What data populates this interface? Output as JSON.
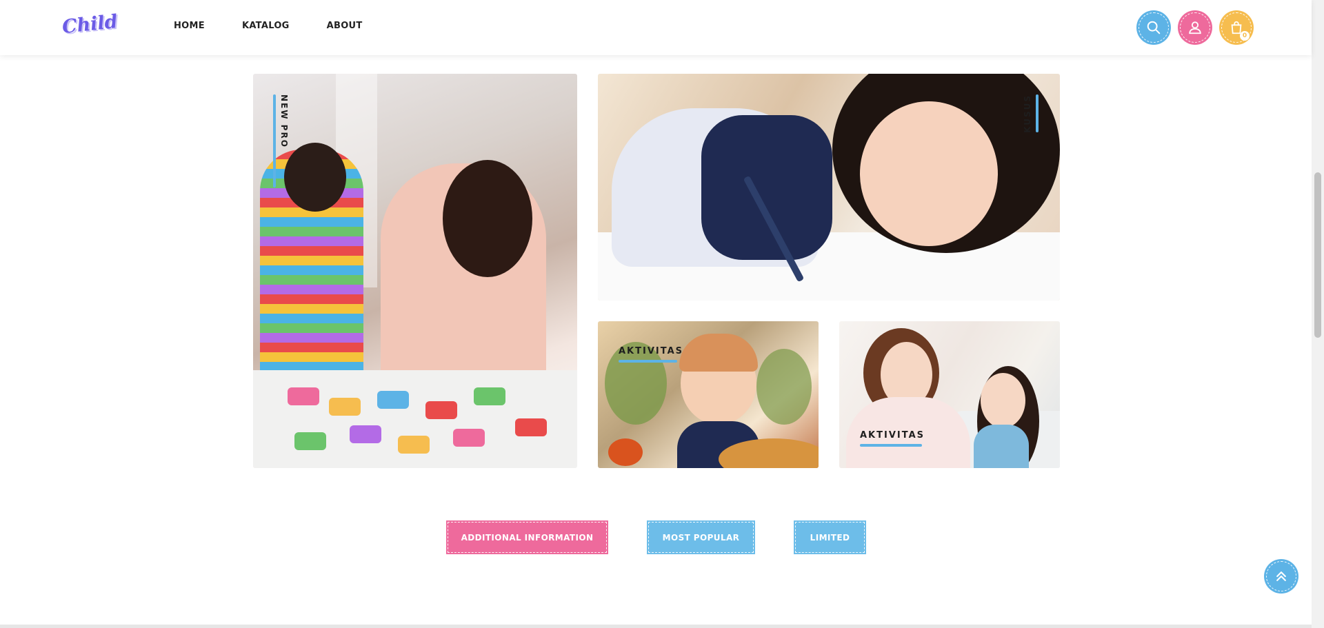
{
  "header": {
    "logo_text": "Child",
    "nav": [
      {
        "label": "HOME"
      },
      {
        "label": "KATALOG"
      },
      {
        "label": "ABOUT"
      }
    ],
    "icons": {
      "search": "search-icon",
      "account": "user-icon",
      "cart": "shopping-bag-icon",
      "cart_count": "0"
    }
  },
  "banners": [
    {
      "label": "NEW PRODUCT",
      "visible_label": "NEW PRO"
    },
    {
      "label": "KUSUS"
    },
    {
      "label": "AKTIVITAS"
    },
    {
      "label": "AKTIVITAS"
    }
  ],
  "tabs": [
    {
      "label": "ADDITIONAL INFORMATION"
    },
    {
      "label": "MOST POPULAR"
    },
    {
      "label": "LIMITED"
    }
  ],
  "colors": {
    "accent_blue": "#5db3e6",
    "accent_pink": "#ee6a9c",
    "accent_yellow": "#f6bd4f",
    "logo_purple": "#6b5be6"
  },
  "back_to_top": "double-chevron-up-icon"
}
